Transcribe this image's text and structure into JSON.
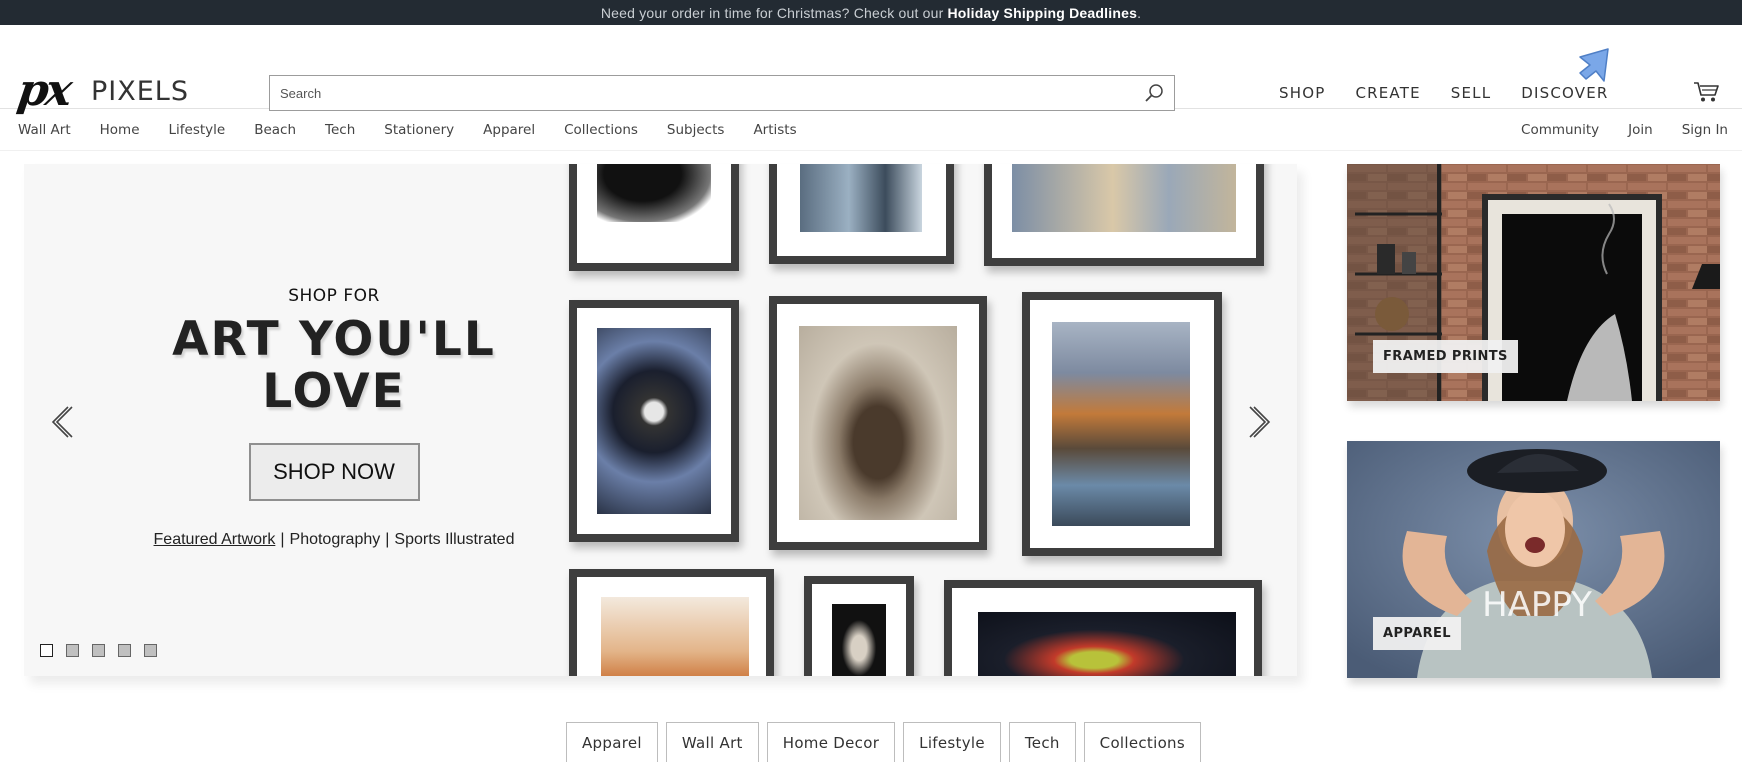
{
  "banner": {
    "text": "Need your order in time for Christmas? Check out our",
    "link": "Holiday Shipping Deadlines",
    "end": "."
  },
  "header": {
    "logo_mark": "px",
    "logo_text": "PIXELS",
    "search_placeholder": "Search",
    "nav": [
      "SHOP",
      "CREATE",
      "SELL",
      "DISCOVER"
    ]
  },
  "catnav": {
    "left": [
      "Wall Art",
      "Home",
      "Lifestyle",
      "Beach",
      "Tech",
      "Stationery",
      "Apparel",
      "Collections",
      "Subjects",
      "Artists"
    ],
    "right": [
      "Community",
      "Join",
      "Sign In"
    ]
  },
  "hero": {
    "subtitle": "SHOP FOR",
    "title_line1": "ART YOU'LL",
    "title_line2": "LOVE",
    "cta": "SHOP NOW",
    "links": [
      "Featured Artwork",
      "Photography",
      "Sports Illustrated"
    ],
    "separator": "|",
    "slides_total": 5,
    "active_slide": 1
  },
  "side_cards": [
    {
      "label": "FRAMED PRINTS"
    },
    {
      "label": "APPAREL",
      "shirt_text": "HAPPY"
    }
  ],
  "category_pills": [
    "Apparel",
    "Wall Art",
    "Home Decor",
    "Lifestyle",
    "Tech",
    "Collections"
  ],
  "colors": {
    "banner_bg": "#232b33",
    "hero_bg": "#f7f7f7",
    "frame": "#3e3e3e",
    "apparel_bg": "#5a6d88",
    "brick": "#9a6650",
    "cursor": "#7aa7e8"
  }
}
